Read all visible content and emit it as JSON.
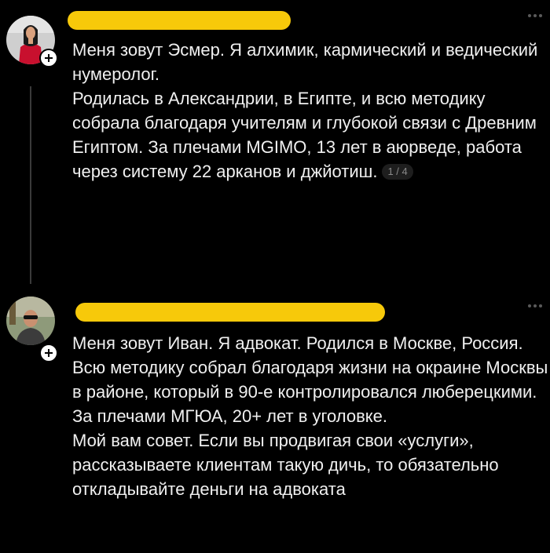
{
  "posts": [
    {
      "avatar_icon": "user-avatar-woman-red-dress",
      "username_redacted": true,
      "more_icon": "more-dots-icon",
      "follow_icon": "plus-icon",
      "paragraphs": [
        "Меня зовут Эсмер. Я алхимик, кармический и ведический нумеролог.",
        "Родилась в Александрии, в Египте, и всю методику собрала благодаря учителям и глубокой связи с Древним Египтом. За плечами MGIMO, 13 лет в аюрведе, работа через систему 22 арканов и джйотиш."
      ],
      "page_indicator": "1 / 4"
    },
    {
      "avatar_icon": "user-avatar-man-sunglasses",
      "username_redacted": true,
      "more_icon": "more-dots-icon",
      "follow_icon": "plus-icon",
      "paragraphs": [
        "Меня зовут Иван. Я адвокат. Родился в Москве, Россия. Всю методику собрал благодаря жизни на окраине Москвы в районе, который в 90-е контролировался люберецкими. За плечами МГЮА, 20+ лет в уголовке.",
        "Мой вам совет. Если вы продвигая свои «услуги», рассказываете клиентам такую дичь, то обязательно откладывайте деньги на адвоката"
      ]
    }
  ],
  "colors": {
    "background": "#000000",
    "text": "#f0f0f0",
    "redaction": "#f7c90a",
    "thread_line": "#3a3a3a",
    "muted": "#8a8a8a"
  }
}
